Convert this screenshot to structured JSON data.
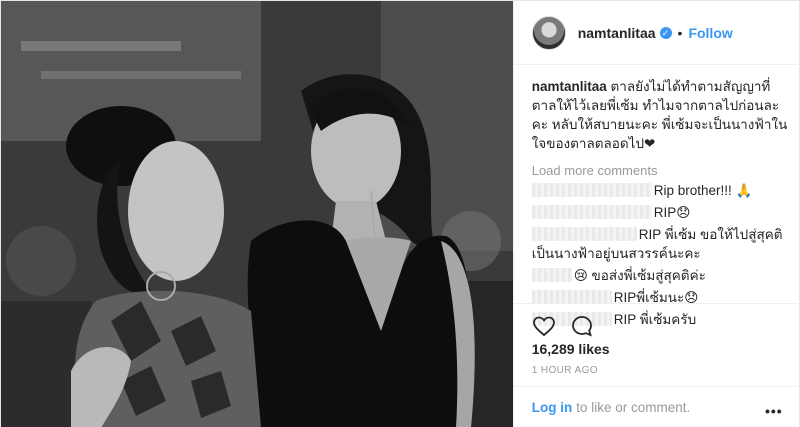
{
  "post": {
    "username": "namtanlitaa",
    "verified_badge": "✓",
    "dot": "•",
    "follow_label": "Follow"
  },
  "caption": {
    "username": "namtanlitaa",
    "text": "ตาลยังไม่ได้ทำตามสัญญาที่ตาลให้ไว้เลยพี่เซ้ม ทำไมจากตาลไปก่อนละคะ หลับให้สบายนะคะ พี่เซ้มจะเป็นนางฟ้าในใจของตาลตลอดไป❤"
  },
  "load_more_label": "Load more comments",
  "comments": [
    {
      "text": "Rip brother!!! 🙏"
    },
    {
      "text": "RIP😞"
    },
    {
      "text": "RIP พี่เซ้ม ขอให้ไปสู่สุคติเป็นนางฟ้าอยู่บนสวรรค์นะคะ"
    },
    {
      "text": "😢 ขอส่งพี่เซ้มสู่สุคติค่ะ"
    },
    {
      "text": "RIPพี่เซ้มนะ😞"
    },
    {
      "text": "RIP พี่เซ้มครับ"
    }
  ],
  "likes_text": "16,289 likes",
  "time_text": "1 HOUR AGO",
  "footer": {
    "login_label": "Log in",
    "rest_text": "to like or comment.",
    "more_label": "•••"
  },
  "icons": {
    "heart": "heart-icon",
    "comment": "comment-icon",
    "verified": "verified-badge-icon",
    "more": "more-options-icon"
  }
}
